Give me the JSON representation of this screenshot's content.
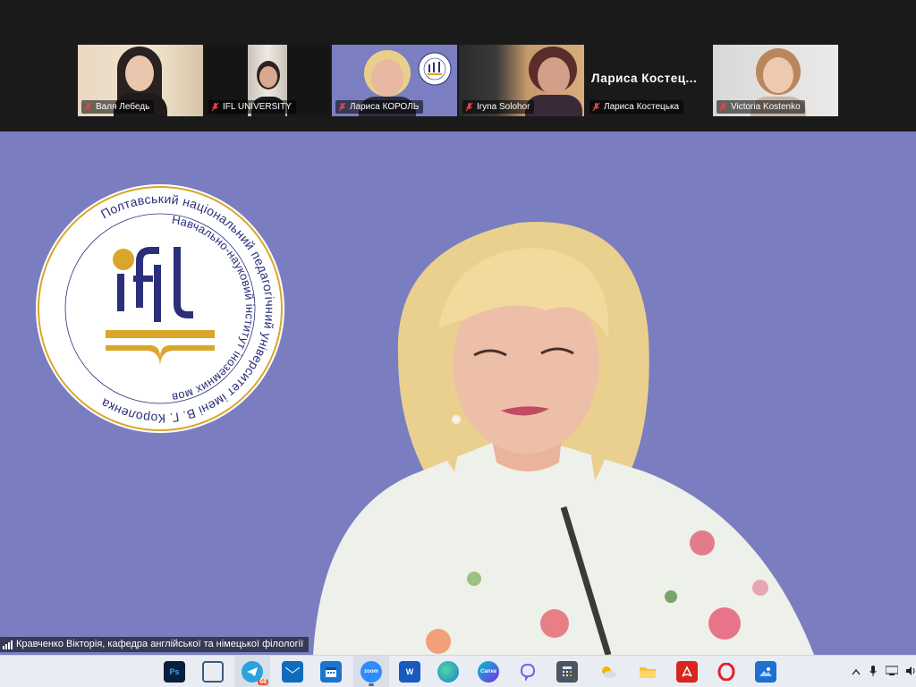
{
  "participants": [
    {
      "name": "Валя Лебедь"
    },
    {
      "name": "IFL UNIVERSITY"
    },
    {
      "name": "Лариса КОРОЛЬ"
    },
    {
      "name": "Iryna Solohor"
    },
    {
      "name": "Лариса Костецька",
      "display_name": "Лариса  Костец..."
    },
    {
      "name": "Victoria Kostenko"
    }
  ],
  "logo": {
    "ring_text": "Полтавський національний педагогічний університет імені В. Г. Короленка",
    "inner_text": "Навчально-науковий інститут іноземних мов",
    "mark": "ifl"
  },
  "speaker": {
    "label": "Кравченко Вікторія, кафедра англійської та німецької філології"
  },
  "taskbar": {
    "apps": [
      "photoshop-icon",
      "app-icon",
      "telegram-icon",
      "mail-icon",
      "calendar-icon",
      "zoom-icon",
      "word-icon",
      "edge-icon",
      "canva-icon",
      "viber-icon",
      "calculator-icon",
      "weather-icon",
      "explorer-icon",
      "acrobat-icon",
      "opera-icon",
      "photos-icon"
    ],
    "ps": "Ps",
    "zoom": "zoom",
    "word": "W",
    "canva": "Canva",
    "telegram_badge": "68"
  },
  "colors": {
    "stage": "#7a7ec0",
    "logo_navy": "#2b2f7a",
    "logo_gold": "#d9a62a"
  }
}
